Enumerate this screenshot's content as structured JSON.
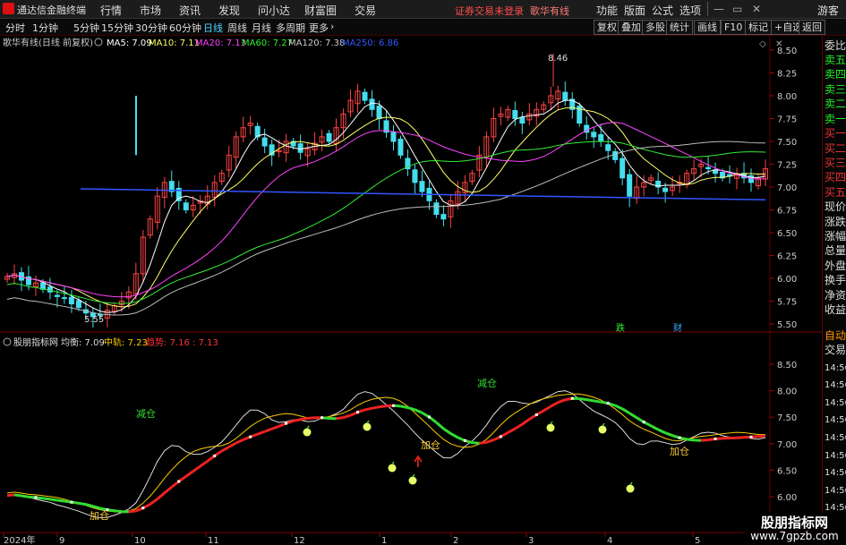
{
  "app": {
    "name": "通达信金融终端",
    "warning": "证券交易未登录",
    "account": "歌华有线",
    "guest": "游客"
  },
  "menus": [
    "行情",
    "市场",
    "资讯",
    "发现",
    "问小达",
    "财富圈",
    "交易"
  ],
  "right_menus": [
    "功能",
    "版面",
    "公式",
    "选项"
  ],
  "timeframes": [
    "分时",
    "1分钟",
    "5分钟",
    "15分钟",
    "30分钟",
    "60分钟",
    "日线",
    "周线",
    "月线",
    "多周期",
    "更多"
  ],
  "active_timeframe": "日线",
  "tool_buttons": [
    "复权",
    "叠加",
    "多股",
    "统计",
    "画线",
    "F10",
    "标记",
    "+自选",
    "返回"
  ],
  "main_legend": {
    "stock": "歌华有线(日线 前复权)",
    "ma": [
      {
        "label": "MA5: 7.09",
        "color": "#ffffff"
      },
      {
        "label": "MA10: 7.11",
        "color": "#ffff66"
      },
      {
        "label": "MA20: 7.13",
        "color": "#ff44ff"
      },
      {
        "label": "MA60: 7.27",
        "color": "#33ee33"
      },
      {
        "label": "MA120: 7.38",
        "color": "#cccccc"
      },
      {
        "label": "MA250: 6.86",
        "color": "#3355ff"
      }
    ]
  },
  "sub_legend": {
    "name": "股朋指标网",
    "items": [
      {
        "label": "均衡: 7.09",
        "color": "#dddddd"
      },
      {
        "label": "中轨: 7.23",
        "color": "#ffcc00"
      },
      {
        "label": "趋势: 7.16 : 7.13",
        "color": "#ff3333"
      }
    ]
  },
  "annotations": {
    "high": "8.46",
    "low": "5.55",
    "die": "跌",
    "cai": "财",
    "jiacang": "加仓",
    "jiancang": "减仓"
  },
  "sidebar": [
    "委比",
    "卖五",
    "卖四",
    "卖三",
    "卖二",
    "卖一",
    "买一",
    "买二",
    "买三",
    "买四",
    "买五",
    "现价",
    "涨跌",
    "涨幅",
    "总量",
    "外盘",
    "换手",
    "净资",
    "收益",
    "自动",
    "交易",
    "14:56",
    "14:56",
    "14:56",
    "14:56",
    "14:56",
    "14:56",
    "14:56",
    "14:56",
    "14:56"
  ],
  "xaxis": [
    "2024年",
    "9",
    "10",
    "11",
    "12",
    "1",
    "2",
    "3",
    "4",
    "5"
  ],
  "watermark": {
    "line1": "股朋指标网",
    "line2": "www.7gpzb.com"
  },
  "chart_data": {
    "type": "candlestick",
    "yaxis_main": [
      "8.50",
      "8.25",
      "8.00",
      "7.75",
      "7.50",
      "7.25",
      "7.00",
      "6.75",
      "6.50",
      "6.25",
      "6.00",
      "5.75",
      "5.50"
    ],
    "yaxis_sub": [
      "8.50",
      "8.00",
      "7.50",
      "7.00",
      "6.50",
      "6.00"
    ],
    "ylim_main": [
      5.4,
      8.6
    ],
    "ylim_sub": [
      5.9,
      8.7
    ],
    "close": [
      6.02,
      6.05,
      5.98,
      5.93,
      5.95,
      5.88,
      5.85,
      5.8,
      5.78,
      5.72,
      5.68,
      5.62,
      5.58,
      5.6,
      5.65,
      5.7,
      5.75,
      5.85,
      6.05,
      6.45,
      6.65,
      6.9,
      7.05,
      6.95,
      6.85,
      6.75,
      6.8,
      6.85,
      6.9,
      7.05,
      7.15,
      7.35,
      7.55,
      7.65,
      7.7,
      7.55,
      7.45,
      7.35,
      7.4,
      7.5,
      7.45,
      7.38,
      7.42,
      7.48,
      7.55,
      7.5,
      7.65,
      7.8,
      7.95,
      8.05,
      7.95,
      7.85,
      7.75,
      7.6,
      7.5,
      7.35,
      7.2,
      7.05,
      6.95,
      6.85,
      6.7,
      6.65,
      6.85,
      6.95,
      7.05,
      7.15,
      7.35,
      7.55,
      7.75,
      7.8,
      7.85,
      7.75,
      7.7,
      7.8,
      7.85,
      7.9,
      8.0,
      8.05,
      7.95,
      7.85,
      7.7,
      7.6,
      7.55,
      7.5,
      7.4,
      7.3,
      7.1,
      6.9,
      7.0,
      7.05,
      7.1,
      7.0,
      6.95,
      7.0,
      7.05,
      7.15,
      7.2,
      7.25,
      7.2,
      7.15,
      7.1,
      7.12,
      7.15,
      7.1,
      7.05,
      7.1,
      7.2
    ],
    "ma250": [
      6.98,
      6.97,
      6.96,
      6.95,
      6.94,
      6.93,
      6.92,
      6.91,
      6.9,
      6.89,
      6.88,
      6.87,
      6.86
    ]
  }
}
